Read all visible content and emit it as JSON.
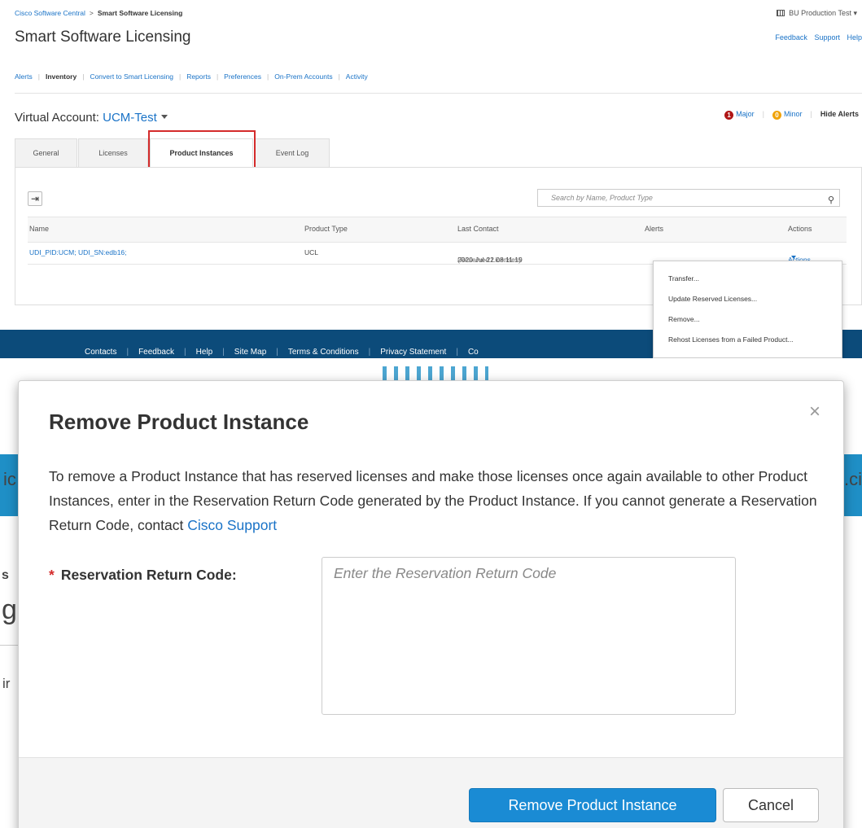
{
  "top": {
    "breadcrumb": {
      "root": "Cisco Software Central",
      "separator": ">",
      "current": "Smart Software Licensing"
    },
    "account_selector": "BU Production Test",
    "page_title": "Smart Software Licensing",
    "header_links": [
      "Feedback",
      "Support",
      "Help"
    ],
    "main_nav": [
      "Alerts",
      "Inventory",
      "Convert to Smart Licensing",
      "Reports",
      "Preferences",
      "On-Prem Accounts",
      "Activity"
    ],
    "main_nav_active": "Inventory",
    "virtual_account": {
      "label": "Virtual Account:",
      "value": "UCM-Test"
    },
    "alerts": {
      "major_count": "1",
      "major_label": "Major",
      "minor_count": "0",
      "minor_label": "Minor",
      "hide_label": "Hide Alerts"
    },
    "tabs": [
      "General",
      "Licenses",
      "Product Instances",
      "Event Log"
    ],
    "active_tab": "Product Instances",
    "search_placeholder": "Search by Name, Product Type",
    "table": {
      "headers": [
        "Name",
        "Product Type",
        "Last Contact",
        "Alerts",
        "Actions"
      ],
      "row": {
        "name": "UDI_PID:UCM; UDI_SN:edb16;",
        "product_type": "UCL",
        "last_contact": "2020-Jul-22 08:11:19",
        "last_contact_note": "(Reserved Licenses)",
        "alerts": "",
        "actions": "Actions"
      }
    },
    "actions_menu": [
      "Transfer...",
      "Update Reserved Licenses...",
      "Remove...",
      "Rehost Licenses from a Failed Product..."
    ],
    "footer_links": [
      "Contacts",
      "Feedback",
      "Help",
      "Site Map",
      "Terms & Conditions",
      "Privacy Statement",
      "Co"
    ]
  },
  "modal": {
    "title": "Remove Product Instance",
    "close_glyph": "×",
    "description": "To remove a Product Instance that has reserved licenses and make those licenses once again available to other Product Instances, enter in the Reservation Return Code generated by the Product Instance. If you cannot generate a Reservation Return Code, contact",
    "support_link": "Cisco Support",
    "field_required_marker": "*",
    "field_label": "Reservation Return Code:",
    "field_placeholder": "Enter the Reservation Return Code",
    "field_value": "",
    "primary_button": "Remove Product Instance",
    "cancel_button": "Cancel"
  },
  "colors": {
    "link_blue": "#1a73c7",
    "primary_button": "#1a8bd4",
    "footer_navy": "#0c4b7a",
    "background_band": "#1f8fc6",
    "highlight_red": "#d42b2b",
    "major_alert": "#b01616",
    "minor_alert": "#f0a30a"
  }
}
